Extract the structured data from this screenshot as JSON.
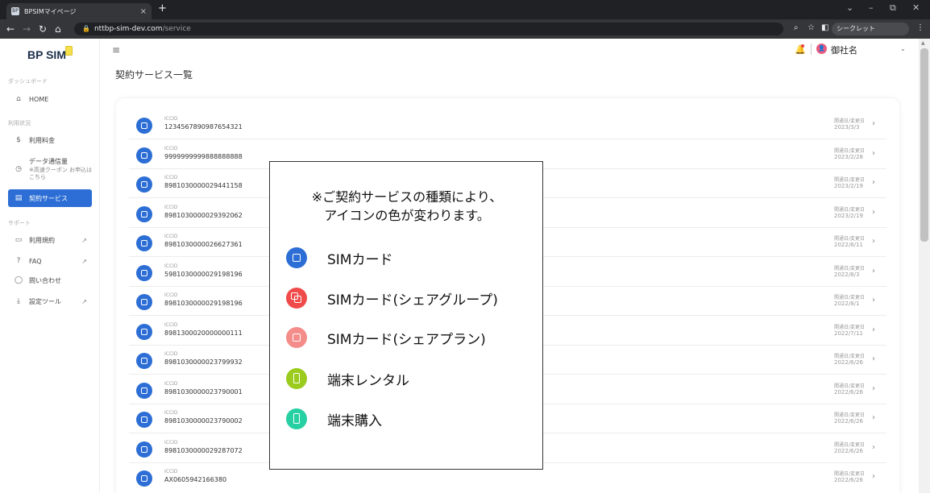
{
  "browser": {
    "tab_title": "BPSIMマイページ",
    "tab_favicon_text": "BP",
    "tab_close": "×",
    "new_tab": "+",
    "url_host": "nttbp-sim-dev.com",
    "url_path": "/service",
    "incognito_label": "シークレット",
    "controls": {
      "dropdown": "⌄",
      "minimize": "–",
      "restore": "⧉",
      "close": "✕"
    }
  },
  "sidebar": {
    "logo": "BP SIM",
    "sections": {
      "dashboard": "ダッシュボード",
      "usage": "利用状況",
      "support": "サポート"
    },
    "items": [
      {
        "label": "HOME",
        "icon": "⌂"
      },
      {
        "label": "利用料金",
        "icon": "$"
      },
      {
        "label": "データ通信量",
        "icon": "◷",
        "sub": "※高速クーポン お申込はこちら"
      },
      {
        "label": "契約サービス",
        "icon": "▤"
      },
      {
        "label": "利用規約",
        "icon": "▭"
      },
      {
        "label": "FAQ",
        "icon": "?"
      },
      {
        "label": "問い合わせ",
        "icon": "◯"
      },
      {
        "label": "設定ツール",
        "icon": "⤓"
      }
    ]
  },
  "header": {
    "user_name": "御社名",
    "avatar_glyph": "👤"
  },
  "page": {
    "title": "契約サービス一覧"
  },
  "list": {
    "id_label": "ICCID",
    "date_label": "開通日/変更日",
    "rows": [
      {
        "iccid": "1234567890987654321",
        "date": "2023/3/3"
      },
      {
        "iccid": "9999999999888888888",
        "date": "2023/2/28"
      },
      {
        "iccid": "8981030000029441158",
        "date": "2023/2/19"
      },
      {
        "iccid": "8981030000029392062",
        "date": "2023/2/19"
      },
      {
        "iccid": "8981030000026627361",
        "date": "2022/8/11"
      },
      {
        "iccid": "5981030000029198196",
        "date": "2022/8/3"
      },
      {
        "iccid": "8981030000029198196",
        "date": "2022/8/1"
      },
      {
        "iccid": "8981300020000000111",
        "date": "2022/7/11"
      },
      {
        "iccid": "8981030000023799932",
        "date": "2022/6/26"
      },
      {
        "iccid": "8981030000023790001",
        "date": "2022/6/26"
      },
      {
        "iccid": "8981030000023790002",
        "date": "2022/6/26"
      },
      {
        "iccid": "8981030000029287072",
        "date": "2022/6/26"
      },
      {
        "iccid": "AX0605942166380",
        "date": "2022/6/26"
      }
    ]
  },
  "legend": {
    "note_line1": "※ご契約サービスの種類により、",
    "note_line2": "アイコンの色が変わります。",
    "items": [
      {
        "label": "SIMカード",
        "color": "#2c6ed5"
      },
      {
        "label": "SIMカード(シェアグループ)",
        "color": "#f04a4a"
      },
      {
        "label": "SIMカード(シェアプラン)",
        "color": "#f48c8a"
      },
      {
        "label": "端末レンタル",
        "color": "#9bcb1c"
      },
      {
        "label": "端末購入",
        "color": "#26d0a2"
      }
    ]
  },
  "colors": {
    "accent": "#2c6ed5"
  }
}
